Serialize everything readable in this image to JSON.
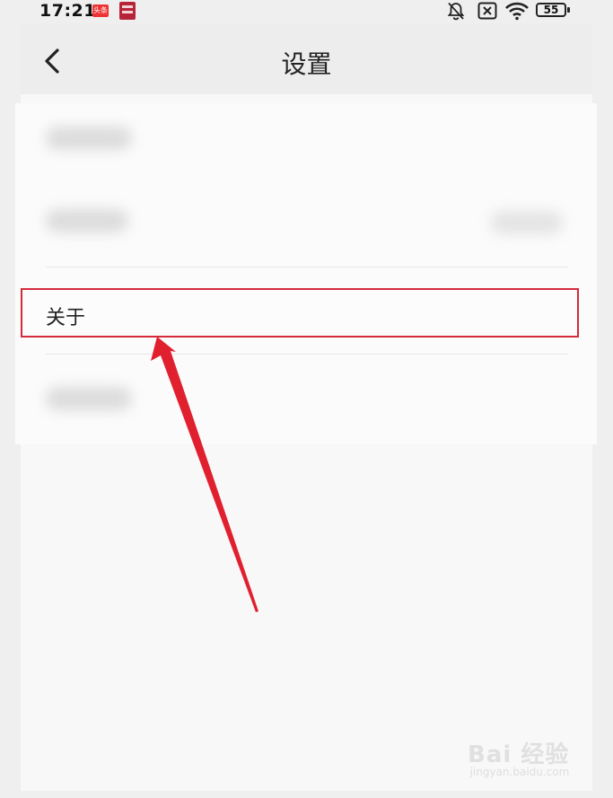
{
  "status_bar": {
    "time": "17:21",
    "app_badge": "头条",
    "battery": "55"
  },
  "header": {
    "title": "设置"
  },
  "settings": {
    "about_label": "关于"
  },
  "watermark": {
    "main": "Bai 经验",
    "sub": "jingyan.baidu.com"
  },
  "colors": {
    "highlight": "#d42a3a",
    "arrow": "#e0202e"
  }
}
